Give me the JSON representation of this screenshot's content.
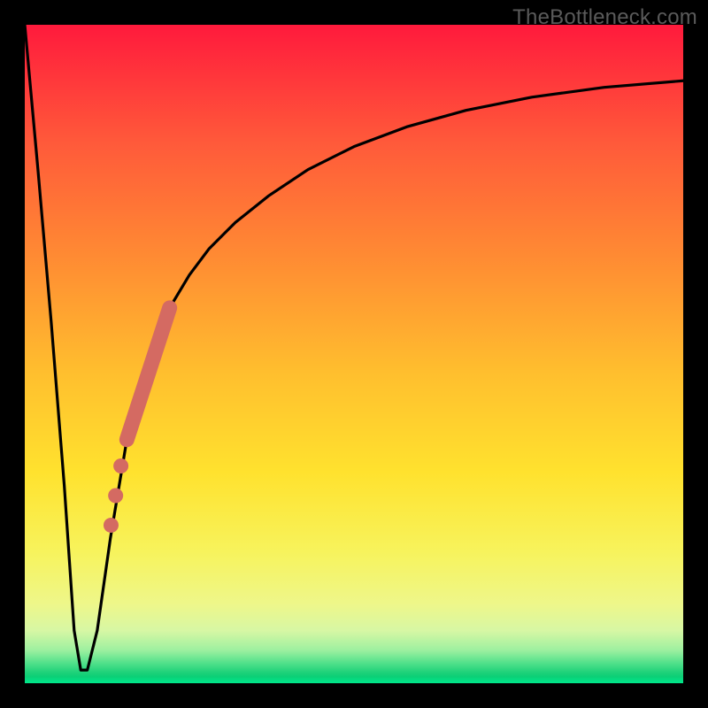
{
  "watermark": "TheBottleneck.com",
  "colors": {
    "frame": "#000000",
    "curve": "#000000",
    "marker": "#d46a62",
    "gradient_top": "#ff1a3c",
    "gradient_bottom": "#00e98c"
  },
  "chart_data": {
    "type": "line",
    "title": "",
    "xlabel": "",
    "ylabel": "",
    "xlim": [
      0,
      100
    ],
    "ylim": [
      0,
      100
    ],
    "grid": false,
    "legend": false,
    "background": "vertical-gradient-red-to-green",
    "series": [
      {
        "name": "bottleneck-curve",
        "x": [
          0,
          2,
          4,
          6,
          7.5,
          8.5,
          9.5,
          11,
          13,
          16,
          19,
          22,
          25,
          28,
          32,
          37,
          43,
          50,
          58,
          67,
          77,
          88,
          100
        ],
        "y": [
          100,
          78,
          55,
          30,
          8,
          2,
          2,
          8,
          22,
          40,
          50,
          57,
          62,
          66,
          70,
          74,
          78,
          81.5,
          84.5,
          87,
          89,
          90.5,
          91.5
        ]
      }
    ],
    "flat_bottom": {
      "x_start": 7.8,
      "x_end": 9.2,
      "y": 2
    },
    "highlights": {
      "name": "highlight-segment",
      "color": "#d46a62",
      "thick_line": {
        "x_start": 15.5,
        "y_start": 37,
        "x_end": 22,
        "y_end": 57
      },
      "dots": [
        {
          "x": 14.6,
          "y": 33
        },
        {
          "x": 13.8,
          "y": 28.5
        },
        {
          "x": 13.1,
          "y": 24
        }
      ]
    }
  }
}
